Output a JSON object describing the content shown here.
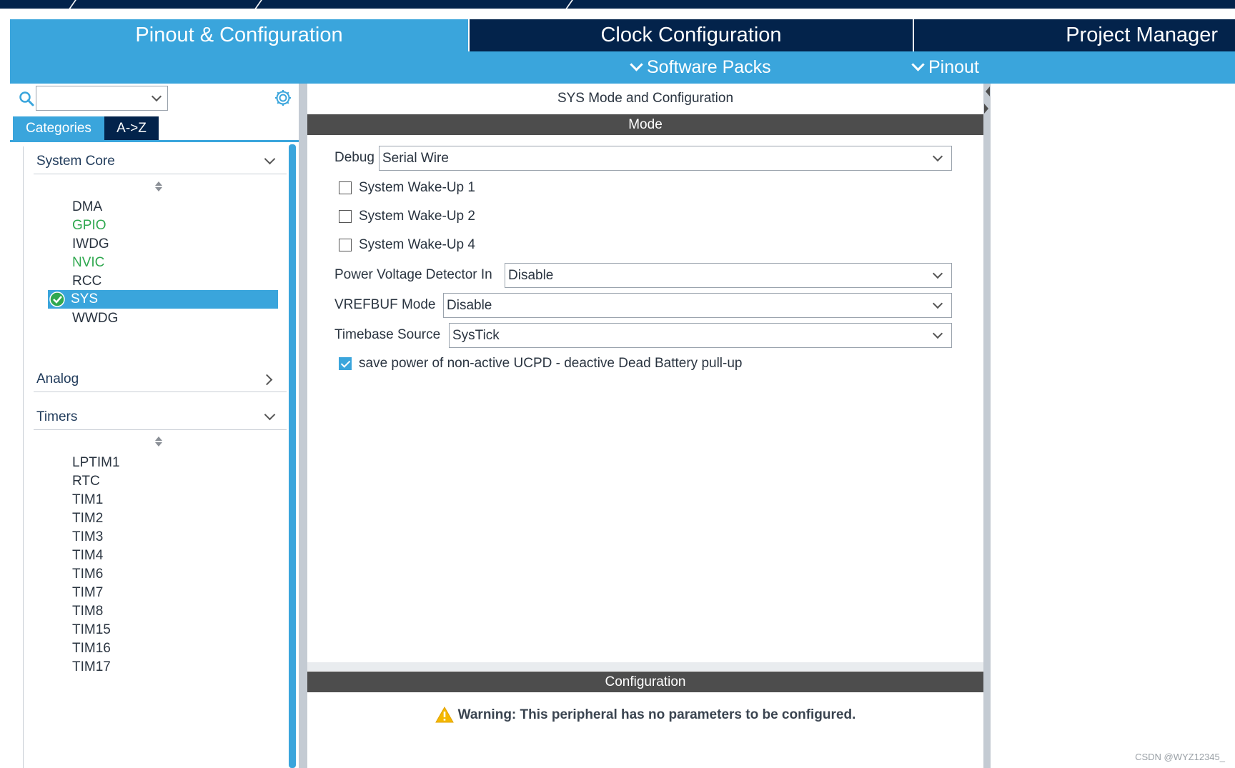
{
  "tabs": {
    "pinout": "Pinout & Configuration",
    "clock": "Clock Configuration",
    "project": "Project Manager"
  },
  "subbar": {
    "software_packs": "Software Packs",
    "pinout": "Pinout"
  },
  "left": {
    "search": {
      "value": ""
    },
    "cat_tabs": {
      "categories": "Categories",
      "az": "A->Z"
    },
    "groups": {
      "system_core": {
        "label": "System Core",
        "items": [
          "DMA",
          "GPIO",
          "IWDG",
          "NVIC",
          "RCC",
          "SYS",
          "WWDG"
        ]
      },
      "analog": {
        "label": "Analog"
      },
      "timers": {
        "label": "Timers",
        "items": [
          "LPTIM1",
          "RTC",
          "TIM1",
          "TIM2",
          "TIM3",
          "TIM4",
          "TIM6",
          "TIM7",
          "TIM8",
          "TIM15",
          "TIM16",
          "TIM17"
        ]
      }
    },
    "selected": "SYS"
  },
  "center": {
    "title": "SYS Mode and Configuration",
    "mode_header": "Mode",
    "debug": {
      "label": "Debug",
      "value": "Serial Wire"
    },
    "wakeups": [
      "System Wake-Up 1",
      "System Wake-Up 2",
      "System Wake-Up 4"
    ],
    "pvd": {
      "label": "Power Voltage Detector In",
      "value": "Disable"
    },
    "vrefbuf": {
      "label": "VREFBUF Mode",
      "value": "Disable"
    },
    "timebase": {
      "label": "Timebase Source",
      "value": "SysTick"
    },
    "ucpd": {
      "label": "save power of non-active UCPD - deactive Dead Battery pull-up",
      "checked": true
    },
    "config_header": "Configuration",
    "warning": "Warning: This peripheral has no parameters to be configured."
  },
  "watermark": "CSDN @WYZ12345_",
  "colors": {
    "navy": "#03234b",
    "accent": "#3aa5dc",
    "green": "#2fa84f",
    "bar": "#4d4d4d",
    "warning": "#f5b800"
  }
}
